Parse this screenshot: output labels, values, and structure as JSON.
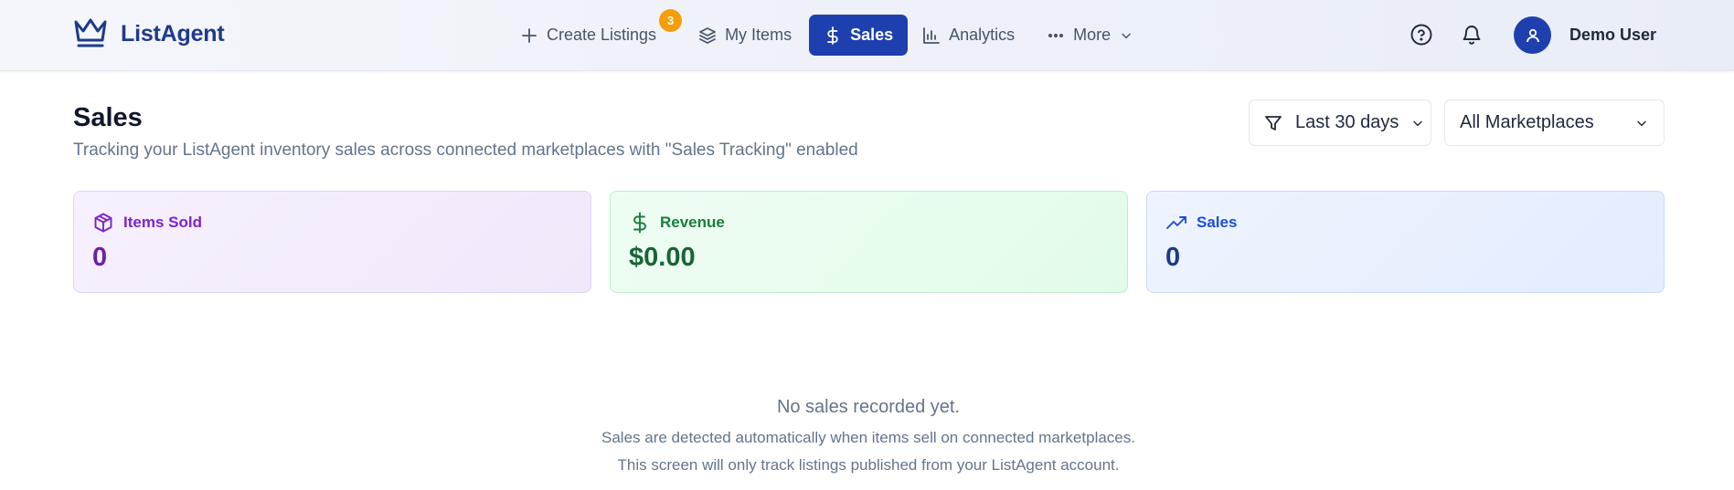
{
  "app": {
    "name": "ListAgent"
  },
  "nav": {
    "create_listings": {
      "label": "Create Listings",
      "badge": "3"
    },
    "my_items": "My Items",
    "sales": "Sales",
    "analytics": "Analytics",
    "more": "More"
  },
  "user": {
    "name": "Demo User"
  },
  "page": {
    "title": "Sales",
    "subtitle": "Tracking your ListAgent inventory sales across connected marketplaces with \"Sales Tracking\" enabled"
  },
  "filters": {
    "date_range": "Last 30 days",
    "marketplace": "All Marketplaces"
  },
  "stats": {
    "items_sold": {
      "label": "Items Sold",
      "value": "0"
    },
    "revenue": {
      "label": "Revenue",
      "value": "$0.00"
    },
    "sales": {
      "label": "Sales",
      "value": "0"
    }
  },
  "empty_state": {
    "title": "No sales recorded yet.",
    "line1": "Sales are detected automatically when items sell on connected marketplaces.",
    "line2": "This screen will only track listings published from your ListAgent account."
  },
  "colors": {
    "brand": "#1e3a8a",
    "active_nav": "#1e40af",
    "badge": "#f59e0b",
    "items_sold": "#7e22ce",
    "revenue": "#15803d",
    "sales": "#1d4ed8"
  }
}
